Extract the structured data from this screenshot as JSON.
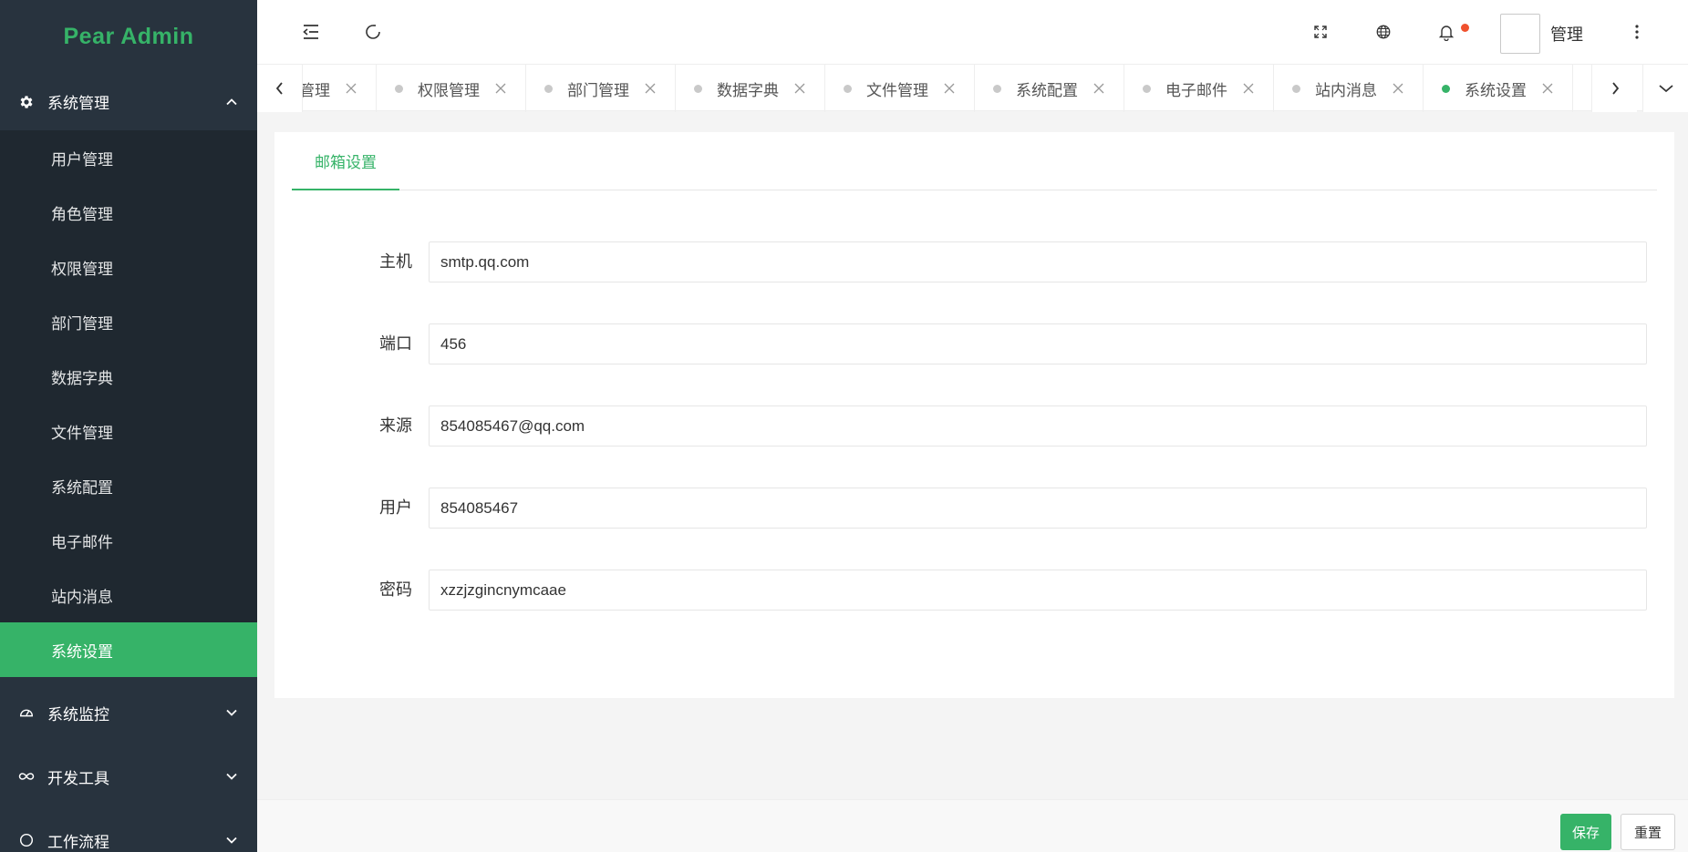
{
  "app": {
    "title": "Pear Admin"
  },
  "sidebar": {
    "group_open": {
      "label": "系统管理",
      "icon": "gear-icon"
    },
    "items": [
      {
        "label": "用户管理"
      },
      {
        "label": "角色管理"
      },
      {
        "label": "权限管理"
      },
      {
        "label": "部门管理"
      },
      {
        "label": "数据字典"
      },
      {
        "label": "文件管理"
      },
      {
        "label": "系统配置"
      },
      {
        "label": "电子邮件"
      },
      {
        "label": "站内消息"
      },
      {
        "label": "系统设置",
        "active": true
      }
    ],
    "groups_closed": [
      {
        "label": "系统监控",
        "icon": "dashboard-icon"
      },
      {
        "label": "开发工具",
        "icon": "infinity-icon"
      },
      {
        "label": "工作流程",
        "icon": "circle-icon"
      }
    ]
  },
  "header": {
    "user_name": "管理",
    "icons": [
      "menu-fold-icon",
      "refresh-icon",
      "fullscreen-icon",
      "globe-icon",
      "bell-icon",
      "more-vertical-icon"
    ]
  },
  "tabs": [
    {
      "label": "角色管理"
    },
    {
      "label": "权限管理"
    },
    {
      "label": "部门管理"
    },
    {
      "label": "数据字典"
    },
    {
      "label": "文件管理"
    },
    {
      "label": "系统配置"
    },
    {
      "label": "电子邮件"
    },
    {
      "label": "站内消息"
    },
    {
      "label": "系统设置",
      "active": true
    }
  ],
  "content": {
    "tab_label": "邮箱设置",
    "fields": {
      "host": {
        "label": "主机",
        "value": "smtp.qq.com"
      },
      "port": {
        "label": "端口",
        "value": "456"
      },
      "from": {
        "label": "来源",
        "value": "854085467@qq.com"
      },
      "user": {
        "label": "用户",
        "value": "854085467"
      },
      "password": {
        "label": "密码",
        "value": "xzzjzgincnymcaae"
      }
    }
  },
  "footer": {
    "save_label": "保存",
    "reset_label": "重置"
  },
  "colors": {
    "accent": "#36b368",
    "sidebar_bg": "#28333e",
    "submenu_bg": "#1f2830",
    "notify_dot": "#f0512e"
  }
}
